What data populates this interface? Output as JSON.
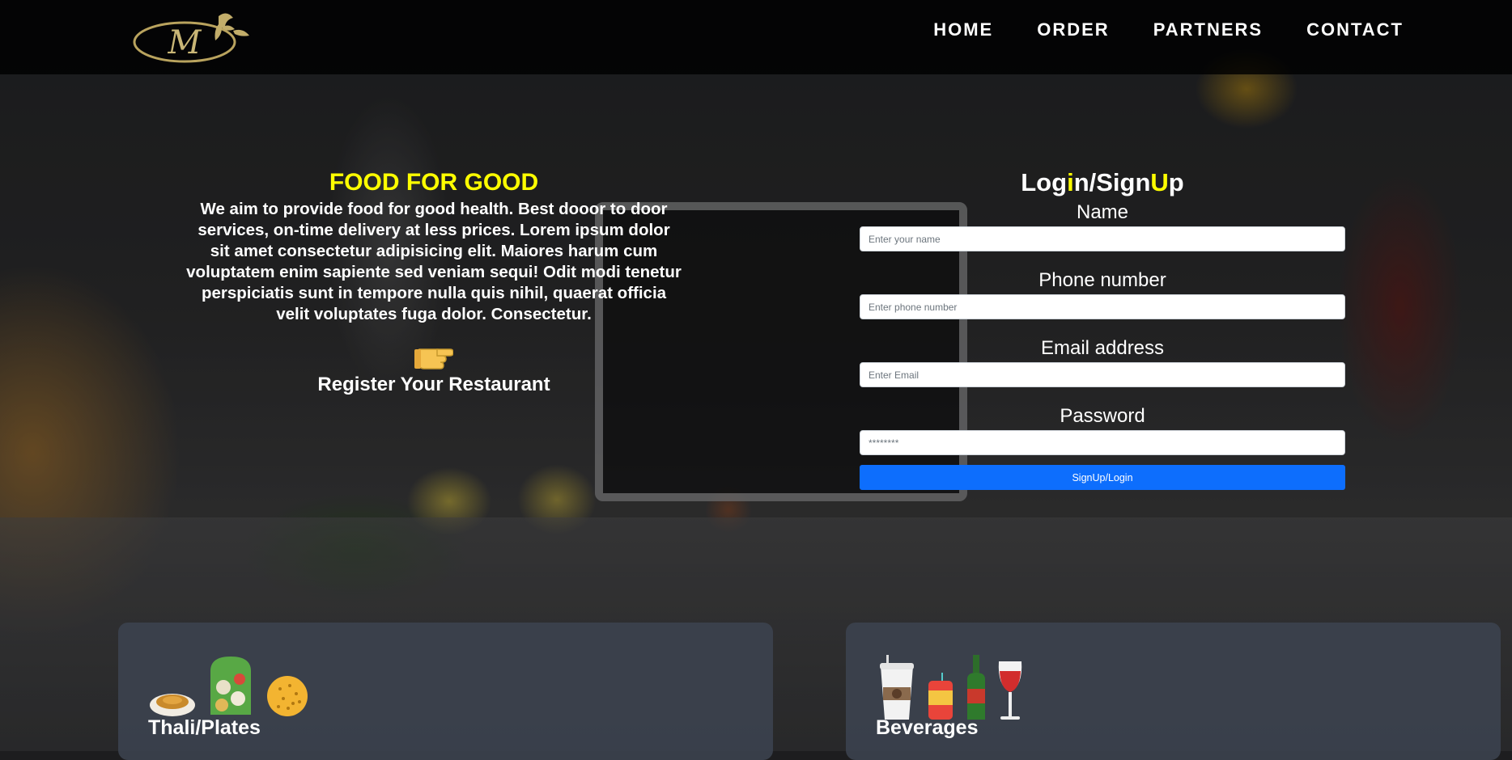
{
  "header": {
    "logo_letter": "M",
    "nav": [
      "HOME",
      "ORDER",
      "PARTNERS",
      "CONTACT"
    ]
  },
  "hero": {
    "title": "FOOD FOR GOOD",
    "description": "We aim to provide food for good health. Best dooor to door services, on-time delivery at less prices. Lorem ipsum dolor sit amet consectetur adipisicing elit. Maiores harum cum voluptatem enim sapiente sed veniam sequi! Odit modi tenetur perspiciatis sunt in tempore nulla quis nihil, quaerat officia velit voluptates fuga dolor. Consectetur.",
    "pointer_icon": "pointing-hand-icon",
    "register_link": "Register Your Restaurant"
  },
  "login": {
    "title_parts": [
      "Log",
      "i",
      "n/Sign",
      "U",
      "p"
    ],
    "highlight_color": "#ffff00",
    "name_label": "Name",
    "name_placeholder": "Enter your name",
    "phone_label": "Phone number",
    "phone_placeholder": "Enter phone number",
    "email_label": "Email address",
    "email_placeholder": "Enter Email",
    "password_label": "Password",
    "password_placeholder": "********",
    "submit_label": "SignUp/Login",
    "submit_color": "#0d6efd"
  },
  "cards": [
    {
      "title": "Thali/Plates",
      "icons": [
        "curry-bowl-icon",
        "thali-plate-icon",
        "biscuit-icon"
      ]
    },
    {
      "title": "Beverages",
      "icons": [
        "coffee-cup-icon",
        "soda-can-icon",
        "wine-bottle-icon",
        "wine-glass-icon"
      ]
    }
  ]
}
